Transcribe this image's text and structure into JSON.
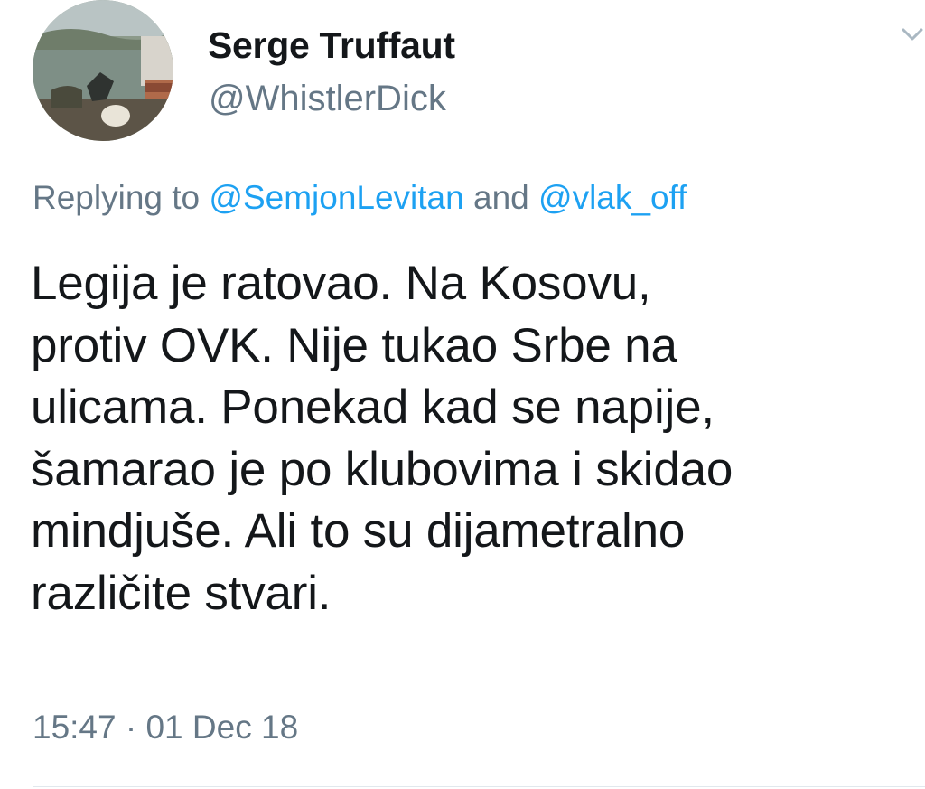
{
  "tweet": {
    "author": {
      "display_name": "Serge Truffaut",
      "handle": "@WhistlerDick",
      "avatar_icon": "profile-photo"
    },
    "menu_icon": "chevron-down-icon",
    "reply": {
      "prefix": "Replying to",
      "mentions": [
        "@SemjonLevitan",
        "@vlak_off"
      ],
      "conjunction": "and"
    },
    "lines": [
      "Legija je ratovao. Na Kosovu,",
      "protiv OVK. Nije tukao Srbe na",
      "ulicama. Ponekad kad se napije,",
      "šamarao je po klubovima i skidao",
      "mindjuše. Ali to su dijametralno",
      "različite stvari."
    ],
    "time": "15:47",
    "separator": "·",
    "date": "01 Dec 18"
  },
  "colors": {
    "text": "#14171a",
    "secondary": "#657786",
    "link": "#1da1f2",
    "divider": "#e1e8ed"
  }
}
